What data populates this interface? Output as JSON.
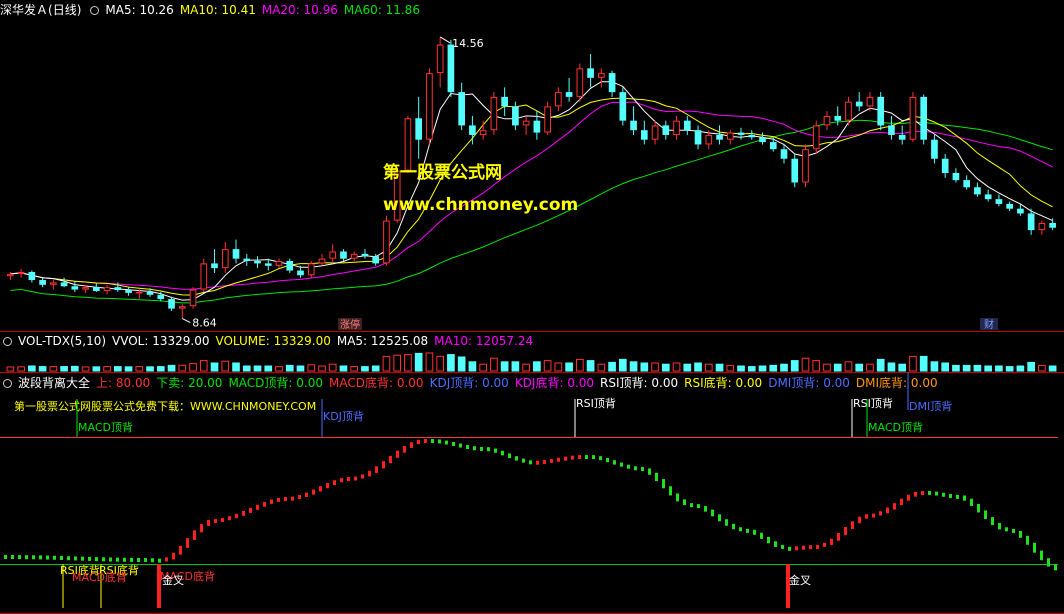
{
  "colors": {
    "background": "#000000",
    "up": "#ff3232",
    "down": "#54ffff",
    "ma5": "#ffffff",
    "ma10": "#ffff00",
    "ma20": "#ff00ff",
    "ma60": "#00e600",
    "separator": "#c80000",
    "wave_up": "#ff2020",
    "wave_down": "#20e020"
  },
  "price_panel": {
    "stock_name": "深华发Ａ",
    "period": "(日线)",
    "ma5_label": "MA5: 10.26",
    "ma10_label": "MA10: 10.41",
    "ma20_label": "MA20: 10.96",
    "ma60_label": "MA60: 11.86",
    "high_marker": "14.56",
    "low_marker": "8.64",
    "tag_left": "涨停",
    "tag_right": "财",
    "watermark_line1": "第一股票公式网",
    "watermark_line2": "www.chnmoney.com"
  },
  "volume_panel": {
    "name": "VOL-TDX(5,10)",
    "vvol": "VVOL: 13329.00",
    "volume": "VOLUME: 13329.00",
    "ma5": "MA5: 12525.08",
    "ma10": "MA10: 12057.24"
  },
  "indicator_panel": {
    "name": "波段背离大全",
    "up": "上: 80.00",
    "down": "下卖: 20.00",
    "macd_top": "MACD顶背: 0.00",
    "macd_bottom": "MACD底背: 0.00",
    "kdj_top": "KDJ顶背: 0.00",
    "kdj_bottom": "KDJ底背: 0.00",
    "rsi_top": "RSI顶背: 0.00",
    "rsi_bottom": "RSI底背: 0.00",
    "dmi_top": "DMI顶背: 0.00",
    "dmi_bottom": "DMI底背: 0.00",
    "banner": "第一股票公式网股票公式免费下载：WWW.CHNMONEY.COM",
    "annotations": [
      {
        "text": "MACD顶背",
        "color": "#00e600"
      },
      {
        "text": "KDJ顶背",
        "color": "#4d6bff"
      },
      {
        "text": "RSI顶背",
        "color": "#ffffff"
      },
      {
        "text": "RSI顶背",
        "color": "#ffffff"
      },
      {
        "text": "DMI顶背",
        "color": "#4d6bff"
      },
      {
        "text": "MACD顶背",
        "color": "#00e600"
      },
      {
        "text": "RSI底背",
        "color": "#ffff00"
      },
      {
        "text": "RSI底背",
        "color": "#ffff00"
      },
      {
        "text": "MACD底背",
        "color": "#ff3232"
      },
      {
        "text": "MACD底背",
        "color": "#ff3232"
      },
      {
        "text": "金叉",
        "color": "#ffffff"
      },
      {
        "text": "金叉",
        "color": "#ffffff"
      }
    ]
  },
  "chart_data": {
    "type": "candlestick",
    "ohlc": [
      [
        9.53,
        9.62,
        9.45,
        9.58
      ],
      [
        9.58,
        9.68,
        9.5,
        9.62
      ],
      [
        9.62,
        9.65,
        9.4,
        9.45
      ],
      [
        9.45,
        9.5,
        9.3,
        9.35
      ],
      [
        9.35,
        9.45,
        9.25,
        9.4
      ],
      [
        9.4,
        9.5,
        9.3,
        9.32
      ],
      [
        9.32,
        9.42,
        9.2,
        9.25
      ],
      [
        9.25,
        9.35,
        9.18,
        9.3
      ],
      [
        9.3,
        9.38,
        9.2,
        9.22
      ],
      [
        9.22,
        9.35,
        9.15,
        9.3
      ],
      [
        9.3,
        9.4,
        9.2,
        9.24
      ],
      [
        9.24,
        9.3,
        9.12,
        9.18
      ],
      [
        9.18,
        9.25,
        9.05,
        9.2
      ],
      [
        9.2,
        9.28,
        9.1,
        9.14
      ],
      [
        9.14,
        9.2,
        9.0,
        9.05
      ],
      [
        9.05,
        9.1,
        8.8,
        8.85
      ],
      [
        8.85,
        8.95,
        8.64,
        8.9
      ],
      [
        8.9,
        9.3,
        8.85,
        9.25
      ],
      [
        9.25,
        9.9,
        9.2,
        9.8
      ],
      [
        9.8,
        10.1,
        9.6,
        9.7
      ],
      [
        9.7,
        10.25,
        9.6,
        10.1
      ],
      [
        10.1,
        10.3,
        9.8,
        9.9
      ],
      [
        9.9,
        10.0,
        9.75,
        9.85
      ],
      [
        9.85,
        9.95,
        9.7,
        9.8
      ],
      [
        9.8,
        9.9,
        9.65,
        9.75
      ],
      [
        9.75,
        9.9,
        9.7,
        9.85
      ],
      [
        9.85,
        9.9,
        9.6,
        9.65
      ],
      [
        9.65,
        9.75,
        9.5,
        9.55
      ],
      [
        9.55,
        9.85,
        9.5,
        9.8
      ],
      [
        9.8,
        10.0,
        9.75,
        9.9
      ],
      [
        9.9,
        10.2,
        9.8,
        10.05
      ],
      [
        10.05,
        10.1,
        9.85,
        9.9
      ],
      [
        9.9,
        10.05,
        9.85,
        10.0
      ],
      [
        10.0,
        10.1,
        9.9,
        9.95
      ],
      [
        9.95,
        10.0,
        9.75,
        9.8
      ],
      [
        9.8,
        10.8,
        9.75,
        10.7
      ],
      [
        10.7,
        11.8,
        10.65,
        11.75
      ],
      [
        11.75,
        12.9,
        11.7,
        12.85
      ],
      [
        12.85,
        13.3,
        12.0,
        12.4
      ],
      [
        12.4,
        13.9,
        12.3,
        13.8
      ],
      [
        13.8,
        14.56,
        13.5,
        14.4
      ],
      [
        14.4,
        14.5,
        13.3,
        13.4
      ],
      [
        13.4,
        13.6,
        12.6,
        12.7
      ],
      [
        12.7,
        12.9,
        12.3,
        12.5
      ],
      [
        12.5,
        12.8,
        12.4,
        12.6
      ],
      [
        12.6,
        13.4,
        12.5,
        13.3
      ],
      [
        13.3,
        13.5,
        12.9,
        13.1
      ],
      [
        13.1,
        13.2,
        12.6,
        12.7
      ],
      [
        12.7,
        12.9,
        12.5,
        12.8
      ],
      [
        12.8,
        13.0,
        12.4,
        12.55
      ],
      [
        12.55,
        13.2,
        12.5,
        13.1
      ],
      [
        13.1,
        13.5,
        13.0,
        13.4
      ],
      [
        13.4,
        13.7,
        13.2,
        13.3
      ],
      [
        13.3,
        14.0,
        13.2,
        13.9
      ],
      [
        13.9,
        14.2,
        13.5,
        13.7
      ],
      [
        13.7,
        13.9,
        13.5,
        13.8
      ],
      [
        13.8,
        13.85,
        13.3,
        13.4
      ],
      [
        13.4,
        13.5,
        12.7,
        12.8
      ],
      [
        12.8,
        13.1,
        12.5,
        12.6
      ],
      [
        12.6,
        12.8,
        12.3,
        12.4
      ],
      [
        12.4,
        12.8,
        12.3,
        12.7
      ],
      [
        12.7,
        12.8,
        12.4,
        12.5
      ],
      [
        12.5,
        12.9,
        12.4,
        12.8
      ],
      [
        12.8,
        12.9,
        12.5,
        12.6
      ],
      [
        12.6,
        12.7,
        12.2,
        12.3
      ],
      [
        12.3,
        12.6,
        12.2,
        12.5
      ],
      [
        12.5,
        12.7,
        12.3,
        12.4
      ],
      [
        12.4,
        12.6,
        12.3,
        12.55
      ],
      [
        12.55,
        12.65,
        12.4,
        12.5
      ],
      [
        12.5,
        12.6,
        12.4,
        12.45
      ],
      [
        12.45,
        12.55,
        12.3,
        12.35
      ],
      [
        12.35,
        12.45,
        12.15,
        12.2
      ],
      [
        12.2,
        12.3,
        11.9,
        12.0
      ],
      [
        12.0,
        12.1,
        11.4,
        11.5
      ],
      [
        11.5,
        12.3,
        11.4,
        12.2
      ],
      [
        12.2,
        12.8,
        12.1,
        12.7
      ],
      [
        12.7,
        13.0,
        12.6,
        12.9
      ],
      [
        12.9,
        13.1,
        12.7,
        12.8
      ],
      [
        12.8,
        13.3,
        12.7,
        13.2
      ],
      [
        13.2,
        13.4,
        13.0,
        13.1
      ],
      [
        13.1,
        13.4,
        13.0,
        13.3
      ],
      [
        13.3,
        13.4,
        12.6,
        12.7
      ],
      [
        12.7,
        12.9,
        12.4,
        12.5
      ],
      [
        12.5,
        12.7,
        12.3,
        12.4
      ],
      [
        12.4,
        13.4,
        12.35,
        13.3
      ],
      [
        13.3,
        13.35,
        12.3,
        12.4
      ],
      [
        12.4,
        12.5,
        11.9,
        12.0
      ],
      [
        12.0,
        12.1,
        11.6,
        11.7
      ],
      [
        11.7,
        11.8,
        11.5,
        11.55
      ],
      [
        11.55,
        11.65,
        11.35,
        11.4
      ],
      [
        11.4,
        11.5,
        11.2,
        11.25
      ],
      [
        11.25,
        11.35,
        11.1,
        11.15
      ],
      [
        11.15,
        11.25,
        11.0,
        11.05
      ],
      [
        11.05,
        11.1,
        10.9,
        10.95
      ],
      [
        10.95,
        11.05,
        10.8,
        10.85
      ],
      [
        10.85,
        10.95,
        10.4,
        10.5
      ],
      [
        10.5,
        10.7,
        10.4,
        10.65
      ],
      [
        10.65,
        10.75,
        10.5,
        10.55
      ]
    ],
    "y_range": [
      8.4,
      15.0
    ]
  }
}
